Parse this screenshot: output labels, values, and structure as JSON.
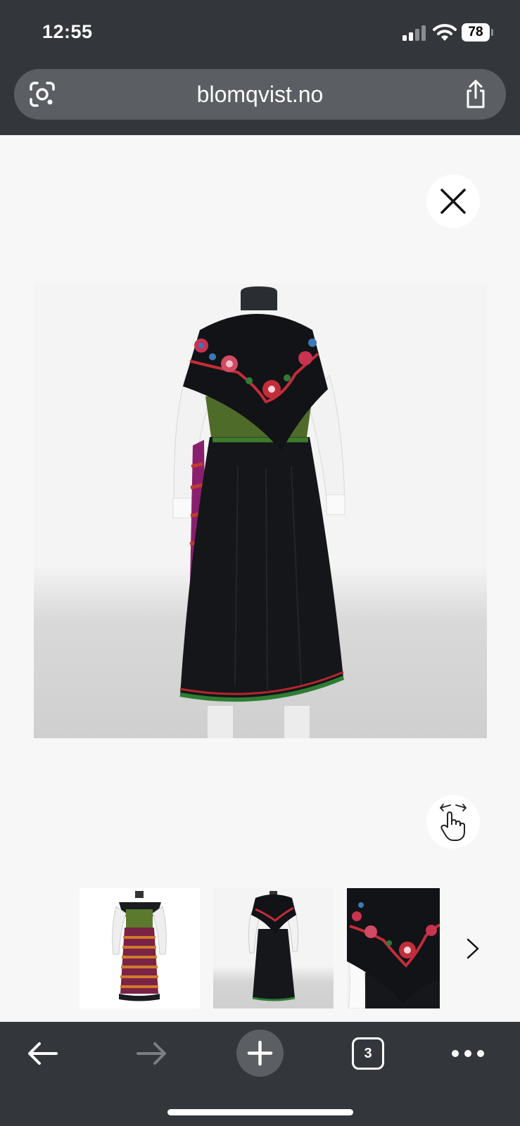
{
  "status": {
    "time": "12:55",
    "battery": "78"
  },
  "browser": {
    "url": "blomqvist.no"
  },
  "toolbar": {
    "tab_count": "3"
  },
  "icons": {
    "lens": "google-lens-icon",
    "share": "share-icon",
    "close": "close-icon",
    "swipe": "swipe-gesture-icon",
    "next": "chevron-right-icon",
    "back": "back-arrow-icon",
    "forward": "forward-arrow-icon",
    "new_tab": "plus-icon",
    "tabs": "tabs-icon",
    "more": "more-icon"
  },
  "colors": {
    "chrome": "#33373b",
    "chip": "#5b5f63",
    "viewer_bg": "#f7f7f7"
  }
}
